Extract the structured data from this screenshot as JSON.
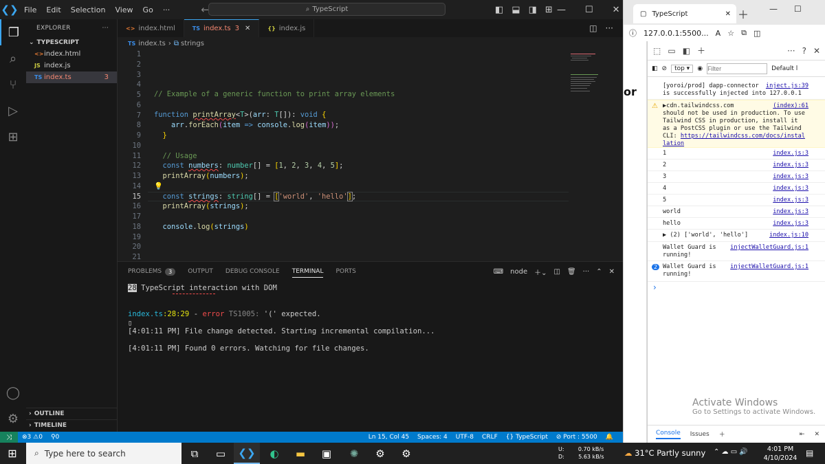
{
  "titlebar": {
    "menus": [
      "File",
      "Edit",
      "Selection",
      "View",
      "Go",
      "···"
    ],
    "search": "TypeScript"
  },
  "explorer": {
    "header": "EXPLORER",
    "folder": "TYPESCRIPT",
    "files": [
      {
        "name": "index.html",
        "icon": "<>",
        "color": "#e37933"
      },
      {
        "name": "index.js",
        "icon": "JS",
        "color": "#cbcb41"
      },
      {
        "name": "index.ts",
        "icon": "TS",
        "color": "#3b8eea",
        "badge": "3"
      }
    ],
    "outline": "OUTLINE",
    "timeline": "TIMELINE"
  },
  "tabs": [
    {
      "label": "index.html",
      "icon": "<>"
    },
    {
      "label": "index.ts",
      "icon": "TS",
      "badge": "3"
    },
    {
      "label": "index.js",
      "icon": "{}"
    }
  ],
  "breadcrumb": {
    "file": "index.ts",
    "symbol": "strings"
  },
  "editor": {
    "line_numbers": [
      "1",
      "2",
      "3",
      "4",
      "5",
      "6",
      "7",
      "8",
      "9",
      "10",
      "11",
      "12",
      "13",
      "14",
      "15",
      "16",
      "17",
      "18",
      "19",
      "20",
      "21"
    ],
    "current_line": "15"
  },
  "panel": {
    "tabs": [
      "PROBLEMS",
      "OUTPUT",
      "DEBUG CONSOLE",
      "TERMINAL",
      "PORTS"
    ],
    "problems_count": "3",
    "terminal_name": "node",
    "lines": {
      "l1_num": "28",
      "l1_text": " TypeScript interaction with DOM",
      "err_file": "index.ts",
      "err_pos": ":28:29",
      "err_sep": " - ",
      "err_word": "error",
      "err_code": " TS1005: ",
      "err_msg": "'(' expected.",
      "l3": "[4:01:11 PM] File change detected. Starting incremental compilation...",
      "l4": "[4:01:11 PM] Found 0 errors. Watching for file changes."
    }
  },
  "statusbar": {
    "errors": "3",
    "warnings": "0",
    "ports": "0",
    "position": "Ln 15, Col 45",
    "spaces": "Spaces: 4",
    "encoding": "UTF-8",
    "eol": "CRLF",
    "language": "TypeScript",
    "port": "Port : 5500"
  },
  "browser": {
    "tab_title": "TypeScript",
    "url": "127.0.0.1:5500...",
    "devtools": {
      "context": "top",
      "filter_placeholder": "Filter",
      "levels": "Default l",
      "logs": [
        {
          "msg": "[yoroi/prod] dapp-connector\nis successfully injected into 127.0.0.1",
          "src": "inject.js:39"
        },
        {
          "msg": "▶cdn.tailwindcss.com\nshould not be used in production. To use\nTailwind CSS in production, install it\nas a PostCSS plugin or use the Tailwind\nCLI: ",
          "link": "https://tailwindcss.com/docs/instal\nlation",
          "src": "(index):61",
          "warn": true
        },
        {
          "msg": "1",
          "src": "index.js:3"
        },
        {
          "msg": "2",
          "src": "index.js:3"
        },
        {
          "msg": "3",
          "src": "index.js:3"
        },
        {
          "msg": "4",
          "src": "index.js:3"
        },
        {
          "msg": "5",
          "src": "index.js:3"
        },
        {
          "msg": "world",
          "src": "index.js:3"
        },
        {
          "msg": "hello",
          "src": "index.js:3"
        },
        {
          "msg": "▶ (2) ['world', 'hello']",
          "src": "index.js:10"
        },
        {
          "msg": "Wallet Guard is\nrunning!",
          "src": "injectWalletGuard.js:1"
        },
        {
          "msg": "Wallet Guard is\nrunning!",
          "src": "injectWalletGuard.js:1",
          "count": "2"
        }
      ],
      "prompt": "›",
      "bottom_tabs": [
        "Console",
        "Issues"
      ],
      "activate_title": "Activate Windows",
      "activate_sub": "Go to Settings to activate Windows."
    }
  },
  "taskbar": {
    "search_placeholder": "Type here to search",
    "upload": "0.70 kB/s",
    "download": "5.63 kB/s",
    "up_label": "U:",
    "down_label": "D:",
    "weather": "31°C  Partly sunny",
    "time": "4:01 PM",
    "date": "4/10/2024"
  }
}
